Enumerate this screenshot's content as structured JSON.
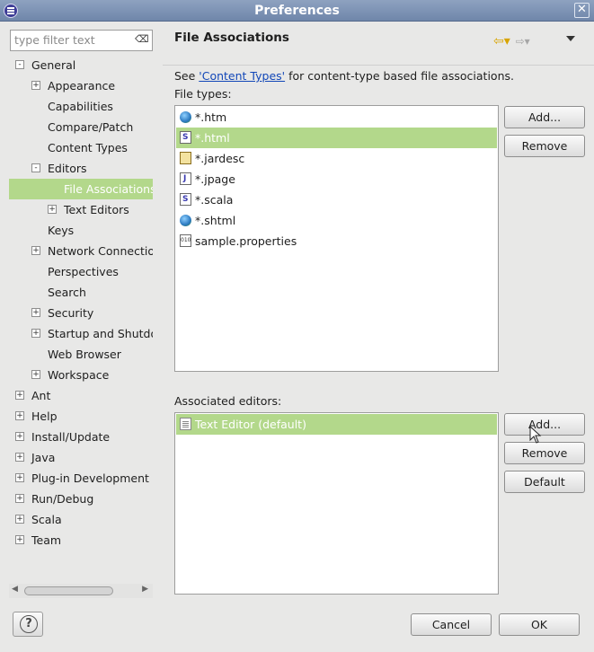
{
  "window": {
    "title": "Preferences"
  },
  "filter": {
    "placeholder": "type filter text"
  },
  "tree": [
    {
      "label": "General",
      "level": 0,
      "expander": "-"
    },
    {
      "label": "Appearance",
      "level": 1,
      "expander": "+"
    },
    {
      "label": "Capabilities",
      "level": 1,
      "expander": ""
    },
    {
      "label": "Compare/Patch",
      "level": 1,
      "expander": ""
    },
    {
      "label": "Content Types",
      "level": 1,
      "expander": ""
    },
    {
      "label": "Editors",
      "level": 1,
      "expander": "-"
    },
    {
      "label": "File Associations",
      "level": 2,
      "expander": "",
      "selected": true
    },
    {
      "label": "Text Editors",
      "level": 2,
      "expander": "+"
    },
    {
      "label": "Keys",
      "level": 1,
      "expander": ""
    },
    {
      "label": "Network Connection",
      "level": 1,
      "expander": "+"
    },
    {
      "label": "Perspectives",
      "level": 1,
      "expander": ""
    },
    {
      "label": "Search",
      "level": 1,
      "expander": ""
    },
    {
      "label": "Security",
      "level": 1,
      "expander": "+"
    },
    {
      "label": "Startup and Shutdown",
      "level": 1,
      "expander": "+"
    },
    {
      "label": "Web Browser",
      "level": 1,
      "expander": ""
    },
    {
      "label": "Workspace",
      "level": 1,
      "expander": "+"
    },
    {
      "label": "Ant",
      "level": 0,
      "expander": "+"
    },
    {
      "label": "Help",
      "level": 0,
      "expander": "+"
    },
    {
      "label": "Install/Update",
      "level": 0,
      "expander": "+"
    },
    {
      "label": "Java",
      "level": 0,
      "expander": "+"
    },
    {
      "label": "Plug-in Development",
      "level": 0,
      "expander": "+"
    },
    {
      "label": "Run/Debug",
      "level": 0,
      "expander": "+"
    },
    {
      "label": "Scala",
      "level": 0,
      "expander": "+"
    },
    {
      "label": "Team",
      "level": 0,
      "expander": "+"
    }
  ],
  "page": {
    "title": "File Associations",
    "see_prefix": "See ",
    "see_link": "'Content Types'",
    "see_suffix": " for content-type based file associations.",
    "file_types_label": "File types:",
    "associated_editors_label": "Associated editors:"
  },
  "file_types": [
    {
      "label": "*.htm",
      "icon": "globe"
    },
    {
      "label": "*.html",
      "icon": "doc",
      "selected": true
    },
    {
      "label": "*.jardesc",
      "icon": "jar"
    },
    {
      "label": "*.jpage",
      "icon": "jpg"
    },
    {
      "label": "*.scala",
      "icon": "doc"
    },
    {
      "label": "*.shtml",
      "icon": "globe"
    },
    {
      "label": "sample.properties",
      "icon": "prop"
    }
  ],
  "editors": [
    {
      "label": "Text Editor (default)",
      "icon": "txt",
      "selected": true
    }
  ],
  "buttons": {
    "add": "Add...",
    "remove": "Remove",
    "default": "Default",
    "cancel": "Cancel",
    "ok": "OK",
    "help": "?"
  }
}
